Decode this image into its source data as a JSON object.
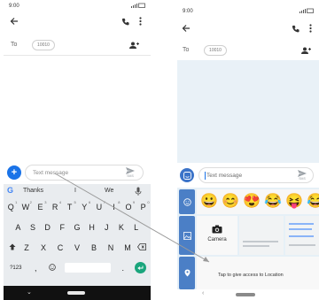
{
  "left_screen": {
    "status_time": "9:00",
    "to_label": "To",
    "recipient": "10010",
    "compose_placeholder": "Text message",
    "send_label": "SMS",
    "suggestions": [
      "Thanks",
      "I",
      "We"
    ],
    "rows": [
      [
        {
          "k": "Q",
          "n": "1"
        },
        {
          "k": "W",
          "n": "2"
        },
        {
          "k": "E",
          "n": "3"
        },
        {
          "k": "R",
          "n": "4"
        },
        {
          "k": "T",
          "n": "5"
        },
        {
          "k": "Y",
          "n": "6"
        },
        {
          "k": "U",
          "n": "7"
        },
        {
          "k": "I",
          "n": "8"
        },
        {
          "k": "O",
          "n": "9"
        },
        {
          "k": "P",
          "n": "0"
        }
      ],
      [
        {
          "k": "A"
        },
        {
          "k": "S"
        },
        {
          "k": "D"
        },
        {
          "k": "F"
        },
        {
          "k": "G"
        },
        {
          "k": "H"
        },
        {
          "k": "J"
        },
        {
          "k": "K"
        },
        {
          "k": "L"
        }
      ],
      [
        {
          "k": "Z"
        },
        {
          "k": "X"
        },
        {
          "k": "C"
        },
        {
          "k": "V"
        },
        {
          "k": "B"
        },
        {
          "k": "N"
        },
        {
          "k": "M"
        }
      ]
    ],
    "symbols_key": "?123",
    "comma_key": ",",
    "period_key": "."
  },
  "right_screen": {
    "status_time": "9:00",
    "to_label": "To",
    "recipient": "10010",
    "compose_placeholder": "Text message",
    "send_label": "SMS",
    "camera_label": "Camera",
    "location_prompt": "Tap to give access to Location",
    "emojis": [
      "😀",
      "😊",
      "😍",
      "😂",
      "😝"
    ]
  }
}
